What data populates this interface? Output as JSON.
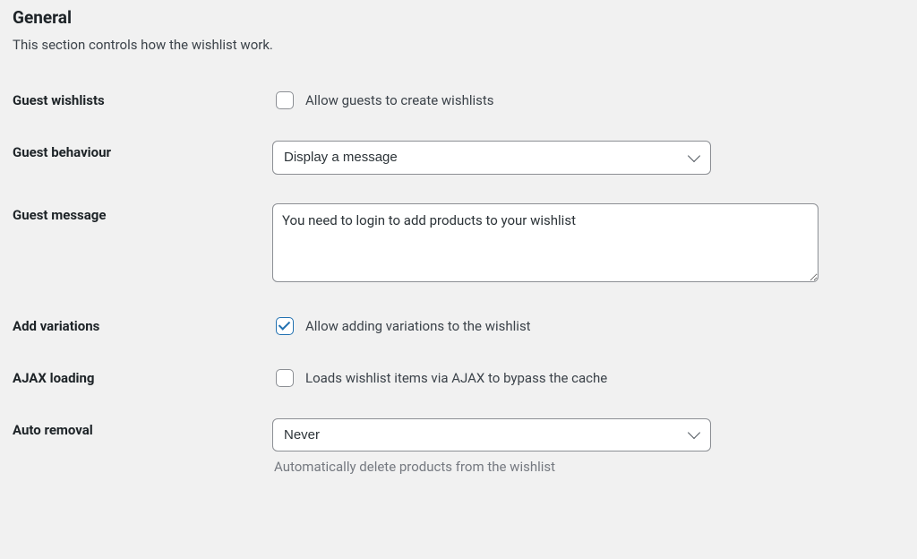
{
  "section": {
    "title": "General",
    "description": "This section controls how the wishlist work."
  },
  "fields": {
    "guest_wishlists": {
      "label": "Guest wishlists",
      "checkbox_label": "Allow guests to create wishlists",
      "checked": false
    },
    "guest_behaviour": {
      "label": "Guest behaviour",
      "value": "Display a message"
    },
    "guest_message": {
      "label": "Guest message",
      "value": "You need to login to add products to your wishlist"
    },
    "add_variations": {
      "label": "Add variations",
      "checkbox_label": "Allow adding variations to the wishlist",
      "checked": true
    },
    "ajax_loading": {
      "label": "AJAX loading",
      "checkbox_label": "Loads wishlist items via AJAX to bypass the cache",
      "checked": false
    },
    "auto_removal": {
      "label": "Auto removal",
      "value": "Never",
      "help": "Automatically delete products from the wishlist"
    }
  }
}
